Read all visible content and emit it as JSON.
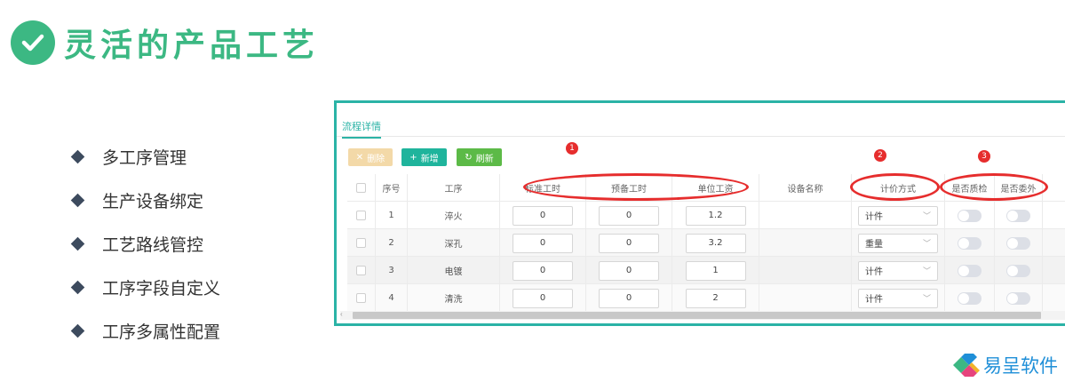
{
  "header": {
    "title": "灵活的产品工艺"
  },
  "features": [
    "多工序管理",
    "生产设备绑定",
    "工艺路线管控",
    "工序字段自定义",
    "工序多属性配置"
  ],
  "panel": {
    "tab": "流程详情",
    "buttons": {
      "delete": "删除",
      "add": "新增",
      "refresh": "刷新"
    },
    "columns": [
      "序号",
      "工序",
      "标准工时",
      "预备工时",
      "单位工资",
      "设备名称",
      "计价方式",
      "是否质检",
      "是否委外"
    ],
    "rows": [
      {
        "seq": "1",
        "process": "淬火",
        "std": "0",
        "prep": "0",
        "wage": "1.2",
        "price": "计件"
      },
      {
        "seq": "2",
        "process": "深孔",
        "std": "0",
        "prep": "0",
        "wage": "3.2",
        "price": "重量"
      },
      {
        "seq": "3",
        "process": "电镀",
        "std": "0",
        "prep": "0",
        "wage": "1",
        "price": "计件"
      },
      {
        "seq": "4",
        "process": "清洗",
        "std": "0",
        "prep": "0",
        "wage": "2",
        "price": "计件"
      }
    ]
  },
  "annotations": [
    "1",
    "2",
    "3"
  ],
  "logo": {
    "text": "易呈软件"
  },
  "colors": {
    "brand_green": "#3cb883",
    "accent_teal": "#2bb3a6",
    "annotation_red": "#e62d2d",
    "logo_blue": "#1f8fd8"
  }
}
